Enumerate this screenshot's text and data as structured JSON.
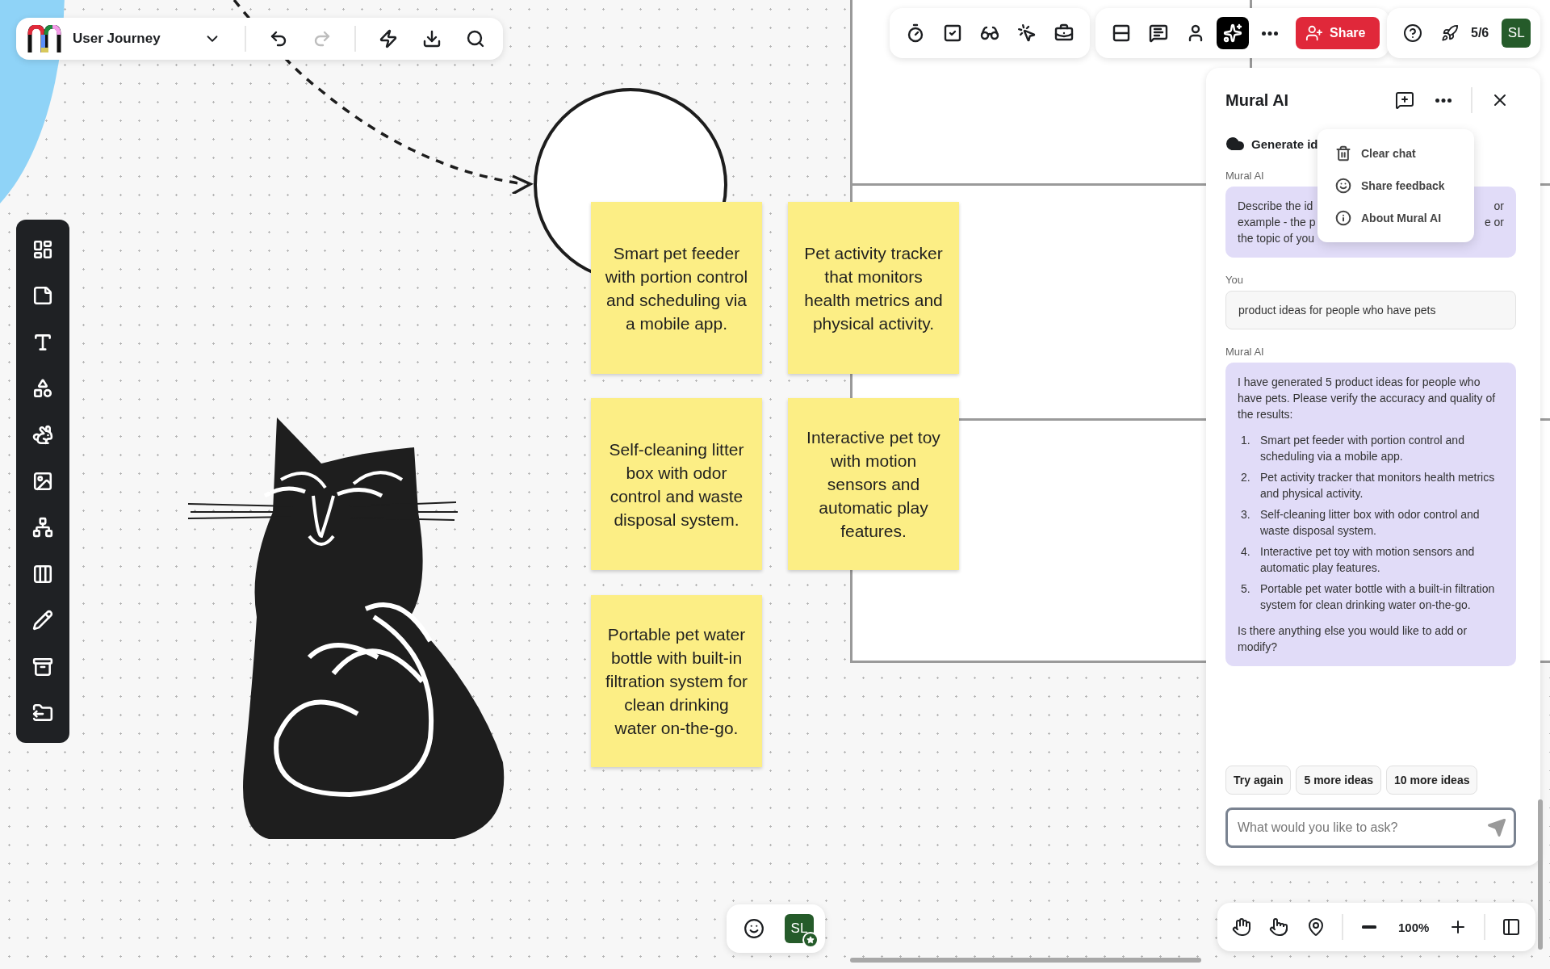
{
  "board_toolbar": {
    "title": "User Journey",
    "history": [
      {
        "kind": "undo",
        "disabled": false
      },
      {
        "kind": "redo",
        "disabled": true
      }
    ],
    "actions": [
      {
        "kind": "lightning"
      },
      {
        "kind": "download"
      },
      {
        "kind": "search"
      }
    ]
  },
  "facilitation_tools": [
    {
      "kind": "timer",
      "selected": false
    },
    {
      "kind": "checkbox",
      "selected": false
    },
    {
      "kind": "incognito",
      "selected": false
    },
    {
      "kind": "laser",
      "selected": false
    },
    {
      "kind": "toolbox",
      "selected": false
    }
  ],
  "collab_tools": [
    {
      "kind": "outline",
      "selected": false
    },
    {
      "kind": "chat",
      "selected": false
    },
    {
      "kind": "person",
      "selected": false
    },
    {
      "kind": "ai",
      "selected": true
    },
    {
      "kind": "more",
      "selected": false
    }
  ],
  "share_button": "Share",
  "progress": "5/6",
  "avatar": "SL",
  "sidebar": [
    {
      "kind": "layout"
    },
    {
      "kind": "sticky"
    },
    {
      "kind": "text"
    },
    {
      "kind": "shapes"
    },
    {
      "kind": "animal"
    },
    {
      "kind": "image"
    },
    {
      "kind": "diagram"
    },
    {
      "kind": "table"
    },
    {
      "kind": "pencil"
    },
    {
      "kind": "archive"
    },
    {
      "kind": "export"
    }
  ],
  "stickies": [
    {
      "text": "Smart pet feeder with portion control and scheduling via a mobile app."
    },
    {
      "text": "Self-cleaning litter box with odor control and waste disposal system."
    },
    {
      "text": "Portable pet water bottle with built-in filtration system for clean drinking water on-the-go."
    },
    {
      "text": "Pet activity tracker that monitors health metrics and physical activity."
    },
    {
      "text": "Interactive pet toy with motion sensors and automatic play features."
    }
  ],
  "ai_panel": {
    "title": "Mural AI",
    "generate_label": "Generate id",
    "menu": {
      "open": true,
      "items": [
        {
          "kind": "delete",
          "label": "Clear chat"
        },
        {
          "kind": "feedback",
          "label": "Share feedback"
        },
        {
          "kind": "info",
          "label": "About Mural AI"
        }
      ]
    },
    "messages": [
      {
        "author": "Mural AI",
        "kind": "partial",
        "lines": [
          {
            "left": "Describe the id",
            "right": "or"
          },
          {
            "left": "example - the p",
            "right": "e or"
          },
          {
            "left": "the topic of you"
          }
        ]
      },
      {
        "author": "You",
        "kind": "user",
        "text": "product ideas for people who have pets"
      },
      {
        "author": "Mural AI",
        "kind": "answer",
        "intro": "I have generated 5 product ideas for people who have pets. Please verify the accuracy and quality of the results:",
        "list": [
          {
            "number": "1.",
            "text": "Smart pet feeder with portion control and scheduling via a mobile app."
          },
          {
            "number": "2.",
            "text": "Pet activity tracker that monitors health metrics and physical activity."
          },
          {
            "number": "3.",
            "text": "Self-cleaning litter box with odor control and waste disposal system."
          },
          {
            "number": "4.",
            "text": "Interactive pet toy with motion sensors and automatic play features."
          },
          {
            "number": "5.",
            "text": "Portable pet water bottle with a built-in filtration system for clean drinking water on-the-go."
          }
        ],
        "outro": "Is there anything else you would like to add or modify?"
      }
    ],
    "suggestions": [
      "Try again",
      "5 more ideas",
      "10 more ideas"
    ],
    "input": {
      "placeholder": "What would you like to ask?"
    }
  },
  "bottom_avatar": "SL",
  "zoom": "100%"
}
